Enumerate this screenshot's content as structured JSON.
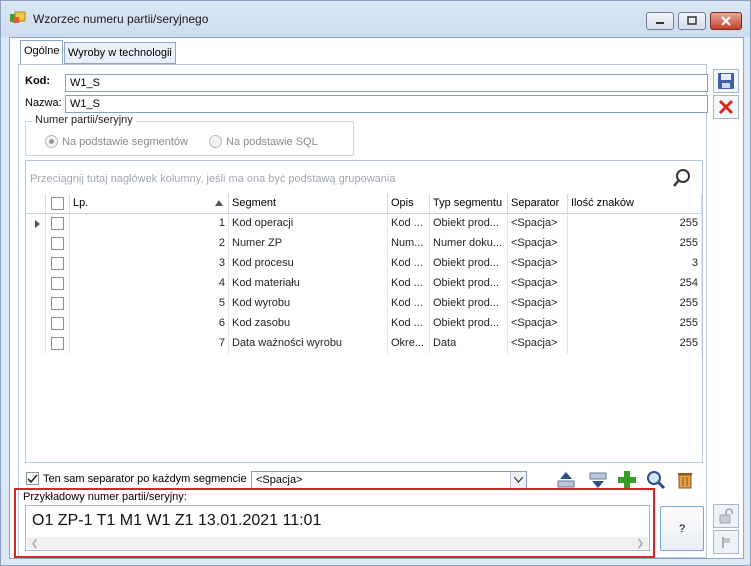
{
  "window": {
    "title": "Wzorzec numeru partii/seryjnego"
  },
  "tabs": [
    {
      "label": "Ogólne",
      "active": true
    },
    {
      "label": "Wyroby w technologii",
      "active": false
    }
  ],
  "form": {
    "kod_label": "Kod:",
    "kod_value": "W1_S",
    "nazwa_label": "Nazwa:",
    "nazwa_value": "W1_S"
  },
  "numer_group": {
    "title": "Numer partii/seryjny",
    "options": [
      {
        "label": "Na podstawie segmentów",
        "selected": true
      },
      {
        "label": "Na podstawie SQL",
        "selected": false
      }
    ]
  },
  "grid": {
    "group_by_placeholder": "Przeciągnij tutaj nagłówek kolumny, jeśli ma ona być podstawą grupowania",
    "columns": [
      "Lp.",
      "Segment",
      "Opis",
      "Typ segmentu",
      "Separator",
      "Ilość znaków"
    ],
    "rows": [
      {
        "lp": "1",
        "segment": "Kod operacji",
        "opis": "Kod ...",
        "typ": "Obiekt prod...",
        "separator": "<Spacja>",
        "ilosc": "255"
      },
      {
        "lp": "2",
        "segment": "Numer ZP",
        "opis": "Num...",
        "typ": "Numer doku...",
        "separator": "<Spacja>",
        "ilosc": "255"
      },
      {
        "lp": "3",
        "segment": "Kod procesu",
        "opis": "Kod ...",
        "typ": "Obiekt prod...",
        "separator": "<Spacja>",
        "ilosc": "3"
      },
      {
        "lp": "4",
        "segment": "Kod materiału",
        "opis": "Kod ...",
        "typ": "Obiekt prod...",
        "separator": "<Spacja>",
        "ilosc": "254"
      },
      {
        "lp": "5",
        "segment": "Kod wyrobu",
        "opis": "Kod ...",
        "typ": "Obiekt prod...",
        "separator": "<Spacja>",
        "ilosc": "255"
      },
      {
        "lp": "6",
        "segment": "Kod zasobu",
        "opis": "Kod ...",
        "typ": "Obiekt prod...",
        "separator": "<Spacja>",
        "ilosc": "255"
      },
      {
        "lp": "7",
        "segment": "Data ważności wyrobu",
        "opis": "Okre...",
        "typ": "Data",
        "separator": "<Spacja>",
        "ilosc": "255"
      }
    ]
  },
  "separator_option": {
    "label": "Ten sam separator po każdym segmencie",
    "checked": true,
    "combo_value": "<Spacja>"
  },
  "sample": {
    "label": "Przykładowy numer partii/seryjny:",
    "value": "O1 ZP-1 T1 M1 W1 Z1 13.01.2021 11:01",
    "button_label": "?"
  },
  "icons": {
    "app": "app-icon",
    "save": "save-icon",
    "cancel": "cancel-icon",
    "search": "search-icon",
    "move_up": "move-up-icon",
    "move_down": "move-down-icon",
    "add": "add-icon",
    "preview": "preview-icon",
    "delete": "trash-icon",
    "lock": "lock-icon"
  },
  "colors": {
    "highlight_frame": "#d6262b",
    "cancel": "#d42a1e",
    "add": "#3a9c2a"
  }
}
